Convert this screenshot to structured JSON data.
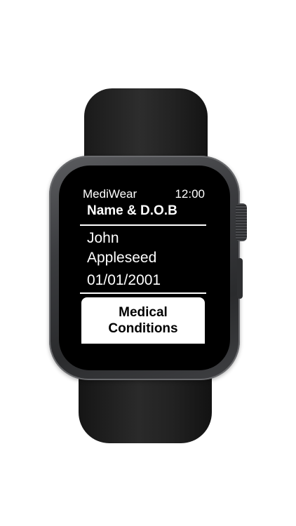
{
  "status_bar": {
    "app_name": "MediWear",
    "time": "12:00"
  },
  "section": {
    "title": "Name & D.O.B"
  },
  "patient": {
    "first_name": "John",
    "last_name": "Appleseed",
    "dob": "01/01/2001"
  },
  "buttons": {
    "medical_conditions_line1": "Medical",
    "medical_conditions_line2": "Conditions"
  },
  "colors": {
    "screen_background": "#000000",
    "text": "#ffffff",
    "button_background": "#ffffff",
    "button_text": "#000000"
  }
}
